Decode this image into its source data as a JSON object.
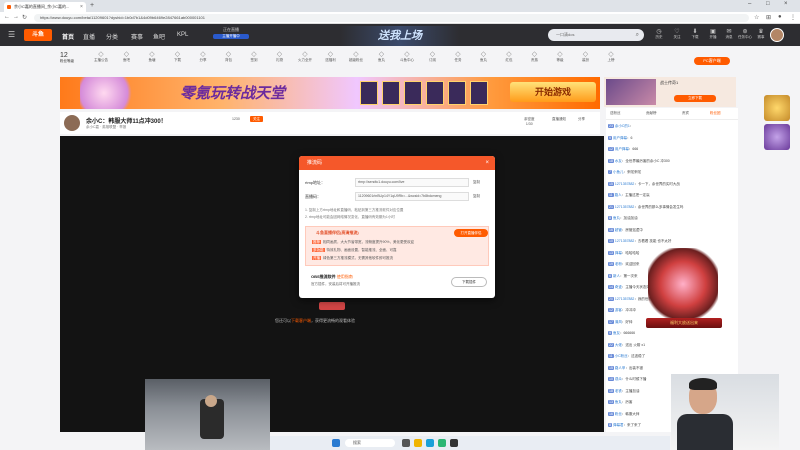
{
  "browser": {
    "tab_title": "余小C嘉的直播间_余小C嘉的...",
    "url": "https://www.douyu.com/beta/11209601?dyshid=1b0d7b1&4d09b6469e2847661ab000001101"
  },
  "header": {
    "menu": "☰",
    "logo": "斗鱼",
    "nav": [
      "首页",
      "直播",
      "分类",
      "赛事",
      "鱼吧",
      "KPL"
    ],
    "live_badge_top": "正在直播",
    "live_badge_sub": "主播开播中",
    "hero_title": "送我上场",
    "search_placeholder": "一口清dos",
    "icons": [
      {
        "name": "history",
        "label": "历史"
      },
      {
        "name": "follow",
        "label": "关注"
      },
      {
        "name": "download",
        "label": "下载"
      },
      {
        "name": "live",
        "label": "开播"
      },
      {
        "name": "message",
        "label": "消息"
      },
      {
        "name": "wallet",
        "label": "任务中心"
      },
      {
        "name": "more",
        "label": "赛事"
      }
    ]
  },
  "fans": {
    "count": "12",
    "label": "粉丝等级"
  },
  "icon_row": [
    "主播公告",
    "鱼吧",
    "鱼塘",
    "下载",
    "分享",
    "背包",
    "签到",
    "礼物",
    "火力全开",
    "送福利",
    "超级粉丝",
    "鱼丸",
    "斗鱼中心",
    "订阅",
    "任务",
    "鱼丸",
    "红包",
    "贵族",
    "等级",
    "装扮",
    "上榜",
    "分享",
    "投票"
  ],
  "banner": {
    "title": "零氪玩转战天堂",
    "cta": "开始游戏"
  },
  "ad": {
    "title": "战士传奇1",
    "button": "立即下载",
    "pc_badge": "PC客户端"
  },
  "room": {
    "title": "余小C：韩服大师11点冲300！",
    "subtitle": "余小C嘉 · 英雄联盟 · 举报",
    "tag": "关注",
    "fans": "1230",
    "stats": [
      {
        "label": "亲密度",
        "value": "1/30"
      },
      {
        "label": "直播通知"
      },
      {
        "label": "分享"
      }
    ]
  },
  "video": {
    "bottom_prefix": "您还可以",
    "bottom_link": "下载客户端",
    "bottom_suffix": "，获得更流畅的观看体验"
  },
  "dialog": {
    "title": "推流码",
    "close": "×",
    "rtmp_label": "rtmp地址：",
    "rtmp_value": "rtmp://sendtc1.douyu.com/live",
    "key_label": "直播码：",
    "key_value": "11209601rlnBUp14Y1qU9Rb=...&wcsid=7b8bdcmeng",
    "copy": "复制",
    "notes": [
      "1. 复制上方rtmp地址和直播码，粘贴到第三方推流软件对应位置",
      "2. rtmp地址可能会因网络情况变化，直播码有效期为1小时"
    ],
    "promo_title": "斗鱼直播伴侣(高清推流)",
    "promo_btn": "打开直播伴侣",
    "promo_lines": [
      {
        "tag": "推荐",
        "text": "相同画质，大大节省带宽，流畅度提升90%，美化更受欢迎"
      },
      {
        "tag": "多功能",
        "text": "特效礼物、画面设置，智能推流、全面、可靠"
      },
      {
        "tag": "开播",
        "text": "绿色第三方推流模式，无需其他软件即可推流"
      }
    ],
    "obs_title": "OBS推流软件",
    "obs_link": "使用指南",
    "obs_desc": "官方插件，安装后将可开播推流",
    "obs_btn": "下载插件"
  },
  "chat": {
    "tabs": [
      "送粉丝",
      "贡献榜",
      "贵宾",
      "粉丝团"
    ],
    "messages": [
      {
        "lv": "23",
        "name": "余小C的1",
        "text": ""
      },
      {
        "lv": "9",
        "name": "用户弹幕",
        "text": "6"
      },
      {
        "lv": "12",
        "name": "用户弹幕",
        "text": "666"
      },
      {
        "lv": "18",
        "name": "水友",
        "text": "全世界最厉害的余小C 冲300"
      },
      {
        "lv": "7",
        "name": "小鱼儿",
        "text": "来啦来啦"
      },
      {
        "lv": "15",
        "name": "1271357882",
        "text": "卡一下，余世界的实时大战"
      },
      {
        "lv": "11",
        "name": "路人",
        "text": "主播这把一定赢"
      },
      {
        "lv": "21",
        "name": "1271357882",
        "text": "余世界的那么多事情会发生吗"
      },
      {
        "lv": "8",
        "name": "鱼丸",
        "text": "加油加油"
      },
      {
        "lv": "16",
        "name": "超管",
        "text": "房管巡逻中"
      },
      {
        "lv": "10",
        "name": "1271357882",
        "text": "去看看 技能 也不太好"
      },
      {
        "lv": "13",
        "name": "弹幕",
        "text": "哈哈哈哈"
      },
      {
        "lv": "19",
        "name": "老粉",
        "text": "欢迎回来"
      },
      {
        "lv": "6",
        "name": "新人",
        "text": "第一次来"
      },
      {
        "lv": "14",
        "name": "奇迹",
        "text": "主播今天状态好"
      },
      {
        "lv": "20",
        "name": "1271357882",
        "text": "我的世界"
      },
      {
        "lv": "12",
        "name": "游客",
        "text": "冲冲冲"
      },
      {
        "lv": "17",
        "name": "清风",
        "text": "好帅"
      },
      {
        "lv": "9",
        "name": "鱼友",
        "text": "666666"
      },
      {
        "lv": "22",
        "name": "大佬",
        "text": "送出 火箭 x1"
      },
      {
        "lv": "11",
        "name": "小C粉丝",
        "text": "这波稳了"
      },
      {
        "lv": "15",
        "name": "路人甲",
        "text": "出装不错"
      },
      {
        "lv": "10",
        "name": "观众",
        "text": "什么时候下播"
      },
      {
        "lv": "18",
        "name": "老铁",
        "text": "主播加油"
      },
      {
        "lv": "13",
        "name": "鱼丸",
        "text": "厉害"
      },
      {
        "lv": "16",
        "name": "粉丝",
        "text": "韩服大师"
      },
      {
        "lv": "8",
        "name": "弹幕君",
        "text": "来了来了"
      }
    ],
    "mascot_label": "福利大放送出来"
  },
  "taskbar": {
    "search": "搜索"
  }
}
